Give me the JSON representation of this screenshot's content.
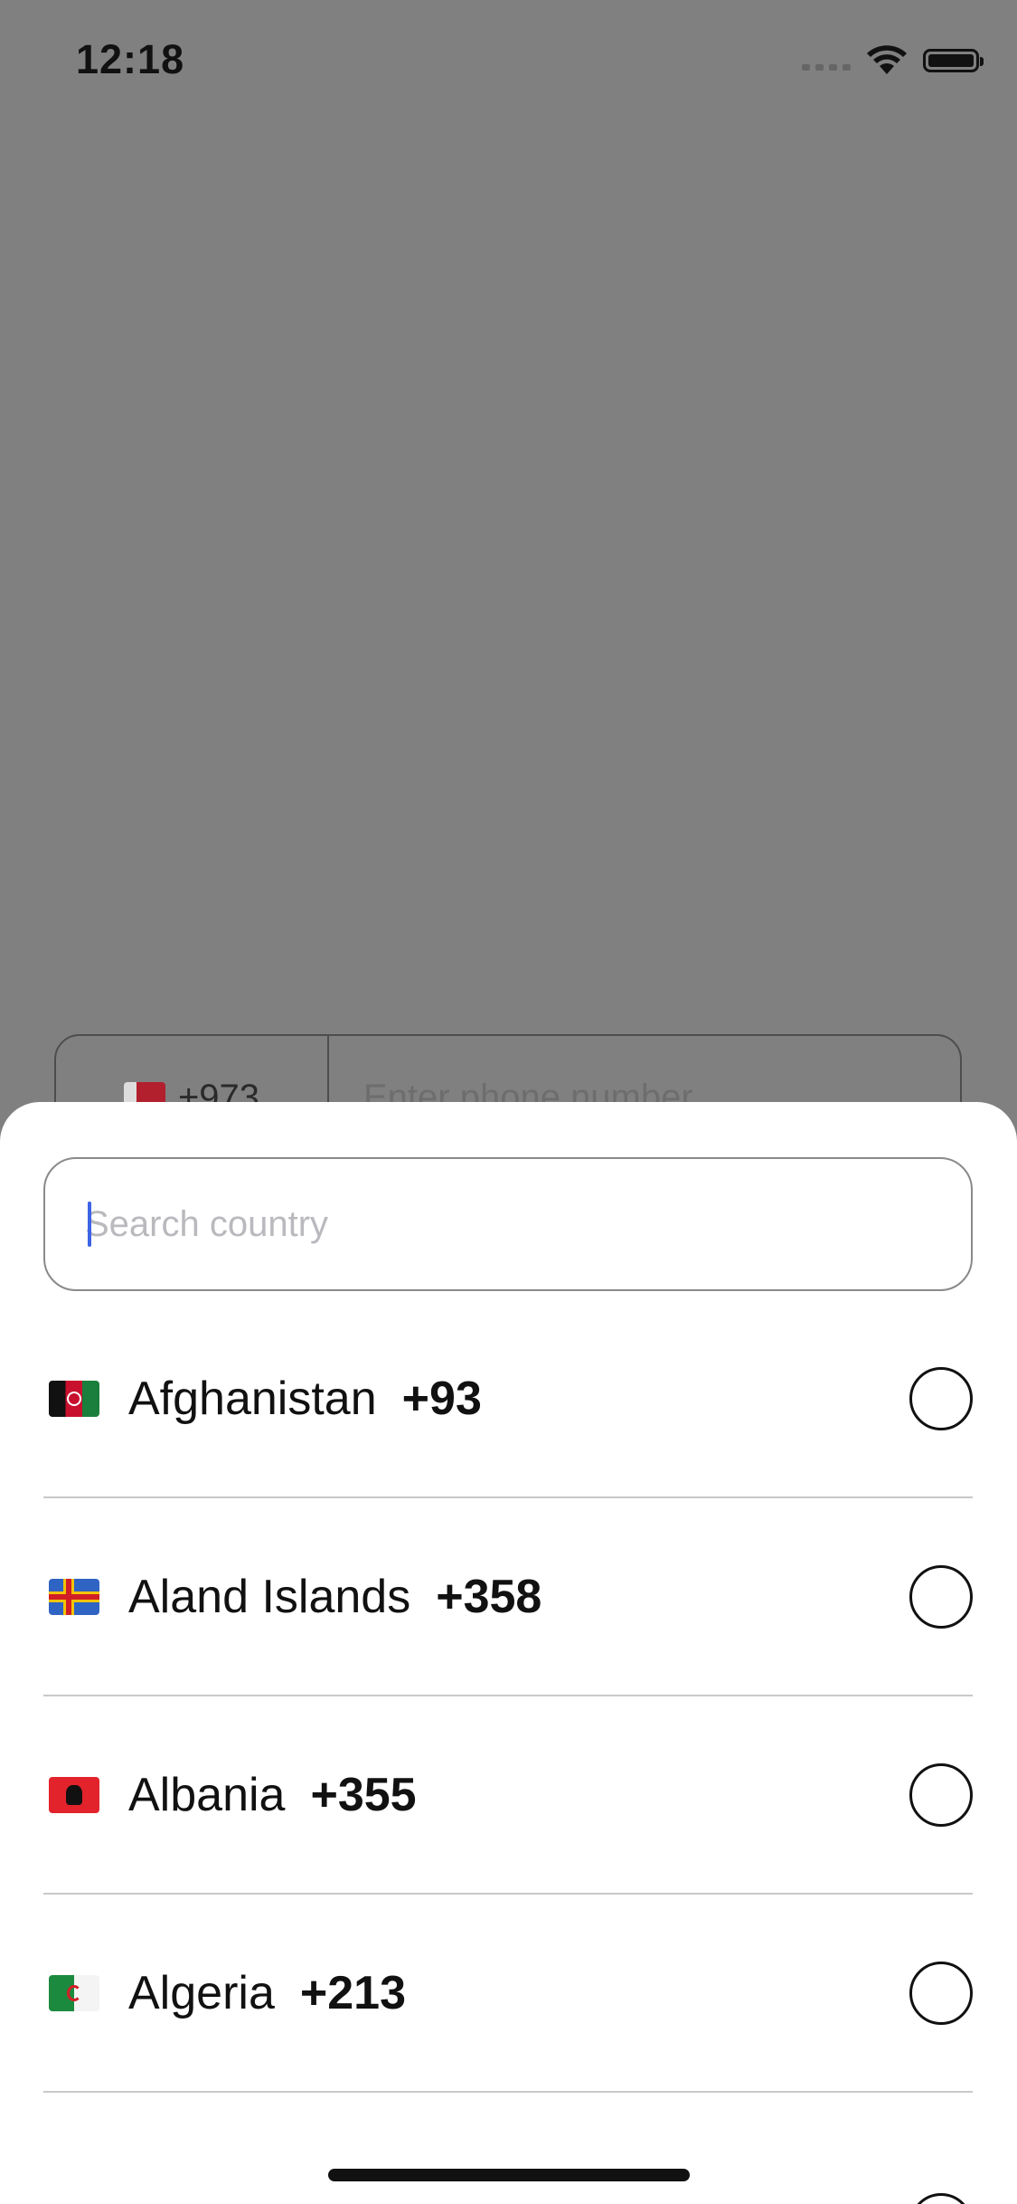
{
  "status_bar": {
    "time": "12:18"
  },
  "background_form": {
    "country_code": "+973",
    "phone_placeholder": "Enter phone number"
  },
  "sheet": {
    "search_placeholder": "Search country",
    "search_value": "",
    "countries": [
      {
        "name": "Afghanistan",
        "code": "+93",
        "flag_icon": "afghanistan-flag-icon"
      },
      {
        "name": "Aland Islands",
        "code": "+358",
        "flag_icon": "aland-islands-flag-icon"
      },
      {
        "name": "Albania",
        "code": "+355",
        "flag_icon": "albania-flag-icon"
      },
      {
        "name": "Algeria",
        "code": "+213",
        "flag_icon": "algeria-flag-icon"
      }
    ]
  },
  "colors": {
    "overlay": "#808080",
    "caret": "#3d63e6",
    "divider": "#c9c9c9",
    "placeholder": "#b9b9be"
  }
}
